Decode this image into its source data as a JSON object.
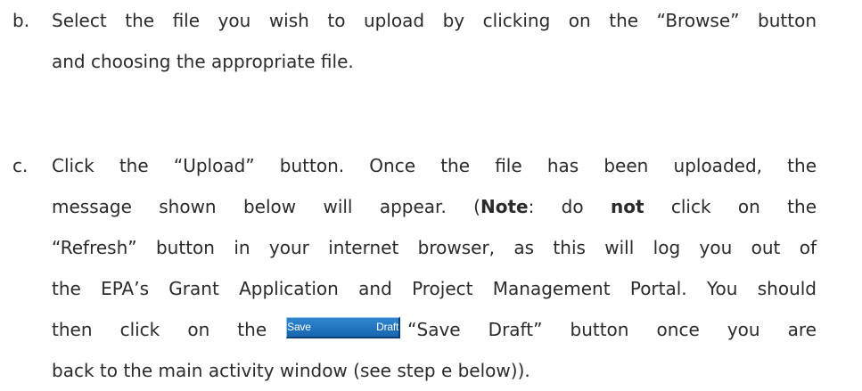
{
  "steps": [
    {
      "letter": "b.",
      "lines": [
        "Select the file you wish to upload by clicking on the “Browse” button",
        "and choosing the appropriate file."
      ]
    },
    {
      "letter": "c.",
      "line1": "Click the “Upload” button. Once the file has been uploaded, the",
      "line2_pre": "message shown below will appear. (",
      "line2_note": "Note",
      "line2_mid": ": do ",
      "line2_not": "not",
      "line2_post": " click on the",
      "line3": "“Refresh” button in your internet browser, as this will log you out of",
      "line4": "the EPA’s Grant Application and Project Management Portal. You should",
      "line5_pre": "then click on the",
      "line5_post": "“Save Draft” button once you are",
      "line6": "back to the main activity window (see step e below))."
    }
  ],
  "save_draft_button": {
    "label": "Save Draft",
    "color": "#1f74c0"
  }
}
